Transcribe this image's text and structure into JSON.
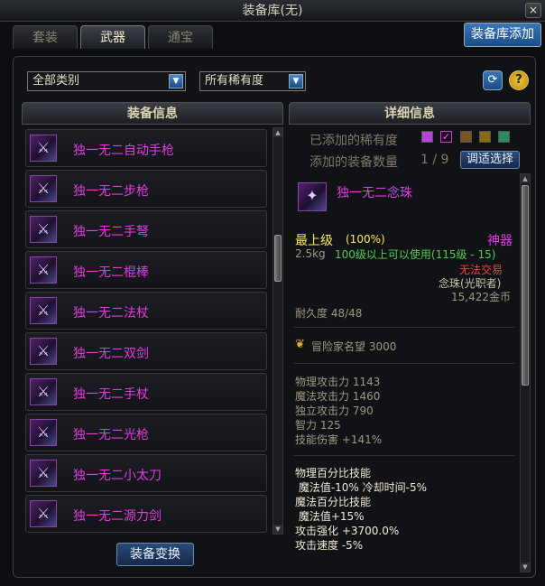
{
  "window": {
    "title": "装备库(无)",
    "close": "×"
  },
  "tabs": [
    {
      "label": "套装",
      "active": false
    },
    {
      "label": "武器",
      "active": true
    },
    {
      "label": "通宝",
      "active": false
    }
  ],
  "add_button": "装备库添加",
  "filters": {
    "category": "全部类别",
    "rarity": "所有稀有度",
    "arrow": "▼"
  },
  "toolbar": {
    "refresh": "⟳",
    "help": "?"
  },
  "headers": {
    "left": "装备信息",
    "right": "详细信息"
  },
  "items": [
    {
      "name": "独一无二自动手枪",
      "icon": "pistol-icon"
    },
    {
      "name": "独一无二步枪",
      "icon": "rifle-icon"
    },
    {
      "name": "独一无二手弩",
      "icon": "crossbow-icon"
    },
    {
      "name": "独一无二棍棒",
      "icon": "club-icon"
    },
    {
      "name": "独一无二法杖",
      "icon": "staff-icon"
    },
    {
      "name": "独一无二双剑",
      "icon": "twin-swords-icon"
    },
    {
      "name": "独一无二手杖",
      "icon": "cane-icon"
    },
    {
      "name": "独一无二光枪",
      "icon": "lance-icon"
    },
    {
      "name": "独一无二小太刀",
      "icon": "short-blade-icon"
    },
    {
      "name": "独一无二源力剑",
      "icon": "force-sword-icon"
    }
  ],
  "convert_button": "装备变换",
  "detail": {
    "added_rarity_label": "已添加的稀有度",
    "rarity_swatches": [
      "#b545d6",
      "#d040d0",
      "#7a5520",
      "#8a6a10",
      "#2a8a60"
    ],
    "add_count_label": "添加的装备数量",
    "add_count": "1 / 9",
    "fit_button": "调适选择",
    "item_name": "独一无二念珠",
    "grade": "最上级",
    "grade_pct": "(100%)",
    "rarity_type": "神器",
    "weight": "2.5kg",
    "level_req": "100级以上可以使用(115级 - 15)",
    "trade": "无法交易",
    "class_req": "念珠(光职者)",
    "price": "15,422金币",
    "durability": "耐久度 48/48",
    "fame": "冒险家名望 3000",
    "stats": [
      "物理攻击力 1143",
      "魔法攻击力 1460",
      "独立攻击力 790",
      "智力 125",
      "技能伤害 +141%"
    ],
    "effects": [
      "物理百分比技能",
      " 魔法值-10% 冷却时间-5%",
      "魔法百分比技能",
      " 魔法值+15%",
      "攻击强化 +3700.0%",
      "攻击速度 -5%"
    ]
  },
  "colors": {
    "item_name": "#e23be2",
    "grade": "#ffe85a",
    "green": "#4fce4f",
    "red": "#ff3b3b"
  }
}
